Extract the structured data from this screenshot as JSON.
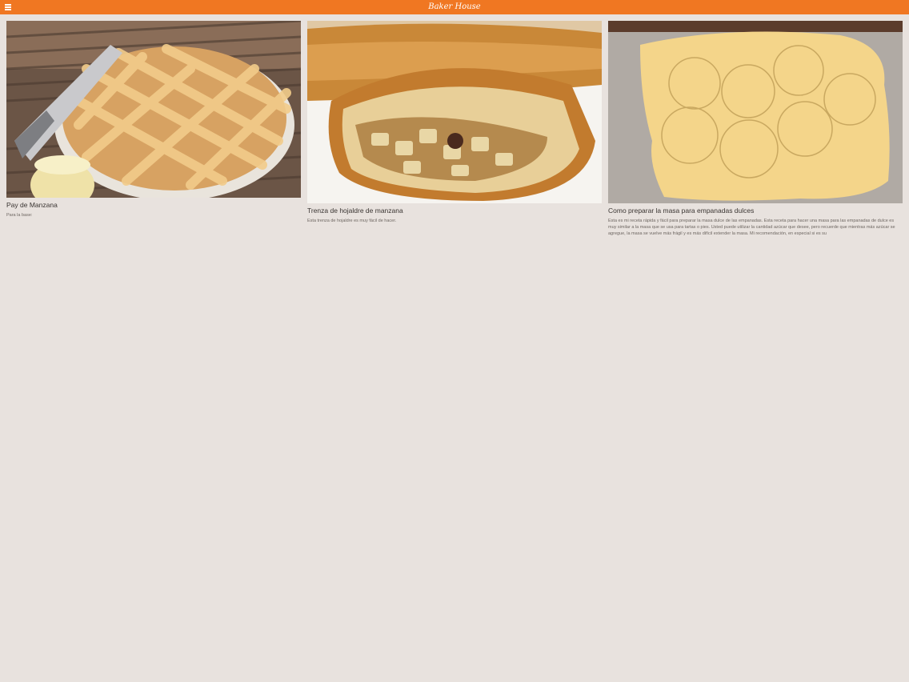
{
  "app": {
    "title": "Baker House"
  },
  "recipes": [
    {
      "title": "Pay de Manzana",
      "description": "Para la base:"
    },
    {
      "title": "Trenza de hojaldre de manzana",
      "description": "Esta trenza de hojaldre es muy fácil de hacer."
    },
    {
      "title": "Como preparar la masa para empanadas dulces",
      "description": "Esta es mi receta rápida y fácil para preparar la masa dulce de las empanadas. Esta receta para hacer una masa para las empanadas de dulce es muy similar a la masa que se usa para tartas o pies. Usted puede utilizar la cantidad azúcar que desee, pero recuerde que mientras más azúcar se agregue, la masa se vuelve más frágil y es más difícil extender la masa. Mi recomendación, en especial si es su"
    }
  ],
  "colors": {
    "topbar": "#f07722",
    "background": "#e8e2de"
  },
  "icons": {
    "menu": "hamburger-menu-icon"
  }
}
